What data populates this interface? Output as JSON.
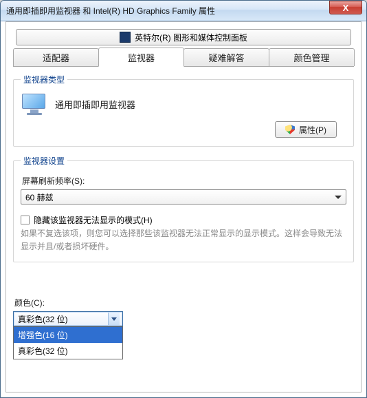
{
  "window": {
    "title": "通用即插即用监视器 和 Intel(R) HD Graphics Family 属性",
    "close_glyph": "X"
  },
  "topbar": {
    "label": "英特尔(R) 图形和媒体控制面板"
  },
  "tabs": {
    "items": [
      {
        "label": "适配器"
      },
      {
        "label": "监视器"
      },
      {
        "label": "疑难解答"
      },
      {
        "label": "颜色管理"
      }
    ],
    "active_index": 1
  },
  "group_type": {
    "legend": "监视器类型",
    "monitor_name": "通用即插即用监视器",
    "properties_btn": "属性(P)"
  },
  "group_settings": {
    "legend": "监视器设置",
    "refresh_label": "屏幕刷新频率(S):",
    "refresh_value": "60 赫兹",
    "hide_modes_label": "隐藏该监视器无法显示的模式(H)",
    "hide_modes_checked": false,
    "help_text": "如果不复选该项，则您可以选择那些该监视器无法正常显示的显示模式。这样会导致无法显示并且/或者损坏硬件。"
  },
  "color": {
    "label": "颜色(C):",
    "selected": "真彩色(32 位)",
    "options": [
      "增强色(16 位)",
      "真彩色(32 位)"
    ],
    "highlight_index": 0
  }
}
